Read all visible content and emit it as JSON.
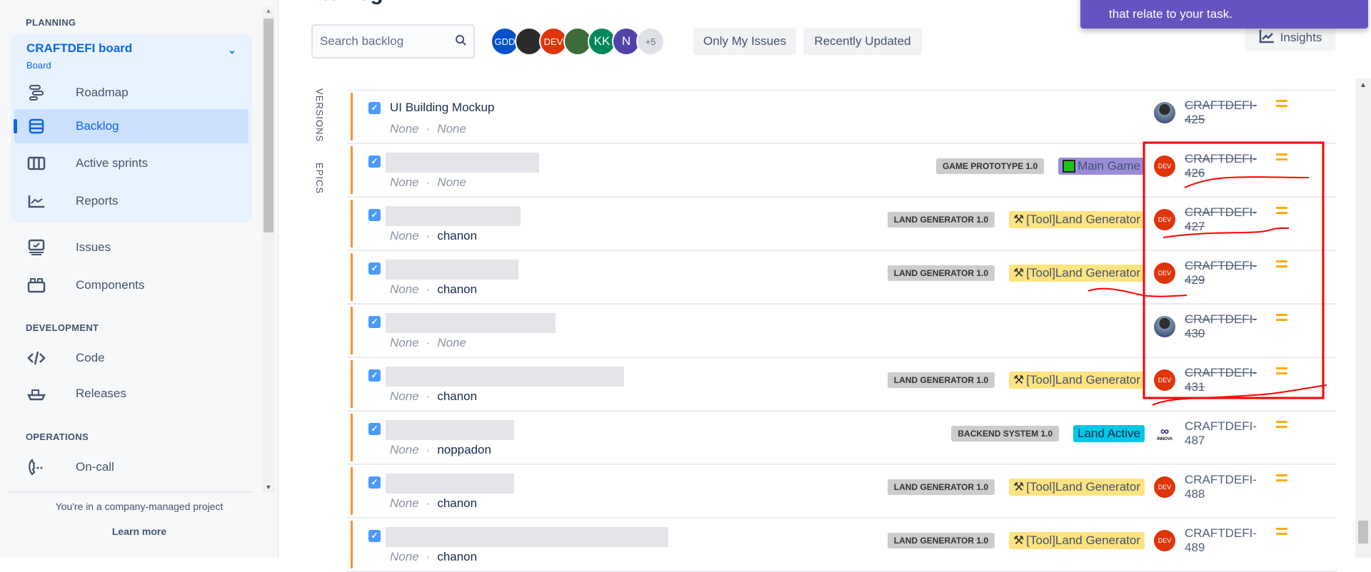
{
  "sidebar": {
    "planning_label": "PLANNING",
    "board_title": "CRAFTDEFI board",
    "board_subtitle": "Board",
    "planning_items": [
      {
        "label": "Roadmap",
        "icon": "roadmap-icon"
      },
      {
        "label": "Backlog",
        "icon": "backlog-icon",
        "active": true
      },
      {
        "label": "Active sprints",
        "icon": "active-sprints-icon"
      },
      {
        "label": "Reports",
        "icon": "reports-icon"
      }
    ],
    "other_items": [
      {
        "label": "Issues",
        "icon": "issues-icon"
      },
      {
        "label": "Components",
        "icon": "components-icon"
      }
    ],
    "development_label": "DEVELOPMENT",
    "development_items": [
      {
        "label": "Code",
        "icon": "code-icon"
      },
      {
        "label": "Releases",
        "icon": "releases-icon"
      }
    ],
    "operations_label": "OPERATIONS",
    "operations_items": [
      {
        "label": "On-call",
        "icon": "on-call-icon"
      }
    ],
    "footer_text": "You're in a company-managed project",
    "learn_more": "Learn more"
  },
  "header": {
    "title": "Backlog",
    "search_placeholder": "Search backlog",
    "avatars": [
      {
        "label": "GDD",
        "color": "#0052cc"
      },
      {
        "label": "",
        "color": "#2b2b2b"
      },
      {
        "label": "DEV",
        "color": "#de350b"
      },
      {
        "label": "",
        "color": "#3d6b3a"
      },
      {
        "label": "KK",
        "color": "#00875a"
      },
      {
        "label": "N",
        "color": "#5243aa"
      },
      {
        "label": "+5",
        "color": "#dfe1e6"
      }
    ],
    "only_my_issues": "Only My Issues",
    "recently_updated": "Recently Updated",
    "insights": "Insights",
    "toast_text": "that relate to your task."
  },
  "side_tabs": {
    "versions": "VERSIONS",
    "epics": "EPICS"
  },
  "issues": [
    {
      "summary": "UI Building Mockup",
      "meta1": "None",
      "meta2": "None",
      "version": "",
      "epic": "",
      "assignee": "photo",
      "key": "CRAFTDEFI-425",
      "done": true
    },
    {
      "summary": "",
      "meta1": "None",
      "meta2": "None",
      "version": "GAME PROTOTYPE 1.0",
      "epic": "Main Game",
      "epic_color": "#998dd9",
      "epic_icon": "green-square",
      "assignee": "DEV",
      "key": "CRAFTDEFI-426",
      "done": true
    },
    {
      "summary": "",
      "meta1": "None",
      "meta2": "chanon",
      "version": "LAND GENERATOR 1.0",
      "epic": "[Tool]Land Generator",
      "epic_color": "#ffe380",
      "epic_icon": "tools-icon",
      "assignee": "DEV",
      "key": "CRAFTDEFI-427",
      "done": true
    },
    {
      "summary": "",
      "meta1": "None",
      "meta2": "chanon",
      "version": "LAND GENERATOR 1.0",
      "epic": "[Tool]Land Generator",
      "epic_color": "#ffe380",
      "epic_icon": "tools-icon",
      "assignee": "DEV",
      "key": "CRAFTDEFI-429",
      "done": true
    },
    {
      "summary": "",
      "meta1": "None",
      "meta2": "None",
      "version": "",
      "epic": "",
      "assignee": "photo",
      "key": "CRAFTDEFI-430",
      "done": true
    },
    {
      "summary": "",
      "meta1": "None",
      "meta2": "chanon",
      "version": "LAND GENERATOR 1.0",
      "epic": "[Tool]Land Generator",
      "epic_color": "#ffe380",
      "epic_icon": "tools-icon",
      "assignee": "DEV",
      "key": "CRAFTDEFI-431",
      "done": true
    },
    {
      "summary": "",
      "meta1": "None",
      "meta2": "noppadon",
      "version": "BACKEND SYSTEM 1.0",
      "epic": "Land Active",
      "epic_color": "#00c7e6",
      "epic_icon": "",
      "assignee": "INNOVA",
      "key": "CRAFTDEFI-487",
      "done": false
    },
    {
      "summary": "",
      "meta1": "None",
      "meta2": "chanon",
      "version": "LAND GENERATOR 1.0",
      "epic": "[Tool]Land Generator",
      "epic_color": "#ffe380",
      "epic_icon": "tools-icon",
      "assignee": "DEV",
      "key": "CRAFTDEFI-488",
      "done": false
    },
    {
      "summary": "",
      "meta1": "None",
      "meta2": "chanon",
      "version": "LAND GENERATOR 1.0",
      "epic": "[Tool]Land Generator",
      "epic_color": "#ffe380",
      "epic_icon": "tools-icon",
      "assignee": "DEV",
      "key": "CRAFTDEFI-489",
      "done": false
    }
  ],
  "colors": {
    "accent": "#0c66e4",
    "annotation": "#ff0000",
    "dev_avatar": "#de350b",
    "priority": "#ffab00"
  }
}
